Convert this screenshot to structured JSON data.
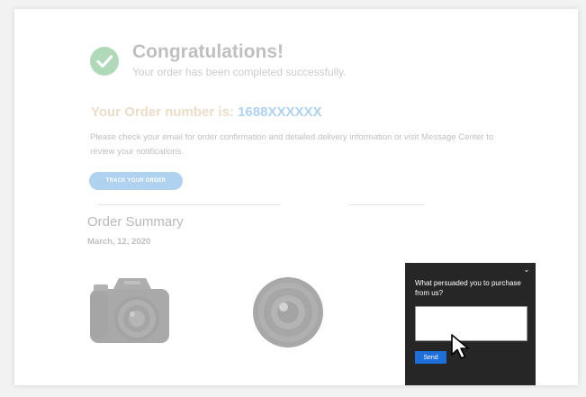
{
  "confirmation": {
    "title": "Congratulations!",
    "subtitle": "Your order has been completed successfully.",
    "order_label": "Your Order number is:",
    "order_number": "1688XXXXXX",
    "description": "Please check your email for order confirmation and detailed delivery information or visit Message Center to review your notifications.",
    "track_button": "TRACK YOUR ORDER"
  },
  "summary": {
    "title": "Order Summary",
    "date": "March, 12, 2020",
    "products": [
      {
        "icon": "camera-icon"
      },
      {
        "icon": "lens-icon"
      }
    ]
  },
  "feedback": {
    "question": "What persuaded you to purchase from us?",
    "input_value": "",
    "send_label": "Send",
    "collapse_icon": "chevron-down-icon"
  },
  "colors": {
    "accent": "#2a88d8",
    "success": "#2e9b45",
    "widget_bg": "#262626",
    "send_button": "#1e6fd9"
  }
}
